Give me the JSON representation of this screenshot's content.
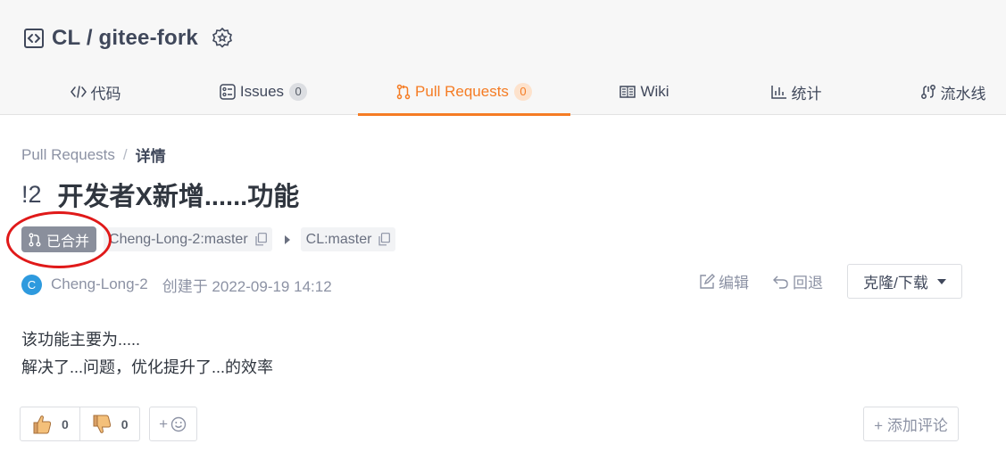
{
  "repo": {
    "title": "CL / gitee-fork"
  },
  "tabs": [
    {
      "label": "代码",
      "icon": "code-icon"
    },
    {
      "label": "Issues",
      "count": "0",
      "icon": "issues-icon"
    },
    {
      "label": "Pull Requests",
      "count": "0",
      "icon": "pull-request-icon",
      "active": true
    },
    {
      "label": "Wiki",
      "icon": "wiki-icon"
    },
    {
      "label": "统计",
      "icon": "stats-icon"
    },
    {
      "label": "流水线",
      "icon": "pipeline-icon"
    }
  ],
  "breadcrumb": {
    "parent": "Pull Requests",
    "separator": "/",
    "current": "详情"
  },
  "pr": {
    "number": "!2",
    "title": "开发者X新增......功能",
    "status": "已合并",
    "source_branch": "Cheng-Long-2:master",
    "target_branch": "CL:master",
    "author_initial": "C",
    "author": "Cheng-Long-2",
    "created": "创建于 2022-09-19 14:12",
    "description": [
      "该功能主要为.....",
      "解决了...问题，优化提升了...的效率"
    ]
  },
  "actions": {
    "edit": "编辑",
    "revert": "回退",
    "clone": "克隆/下载"
  },
  "reactions": {
    "thumbs_up": "0",
    "thumbs_down": "0",
    "add_emoji": "+",
    "add_comment": "+ 添加评论"
  },
  "colors": {
    "accent": "#f57c24",
    "merged_badge": "#8a8f9c",
    "annotation_circle": "#e01919",
    "avatar": "#2e9ade"
  }
}
